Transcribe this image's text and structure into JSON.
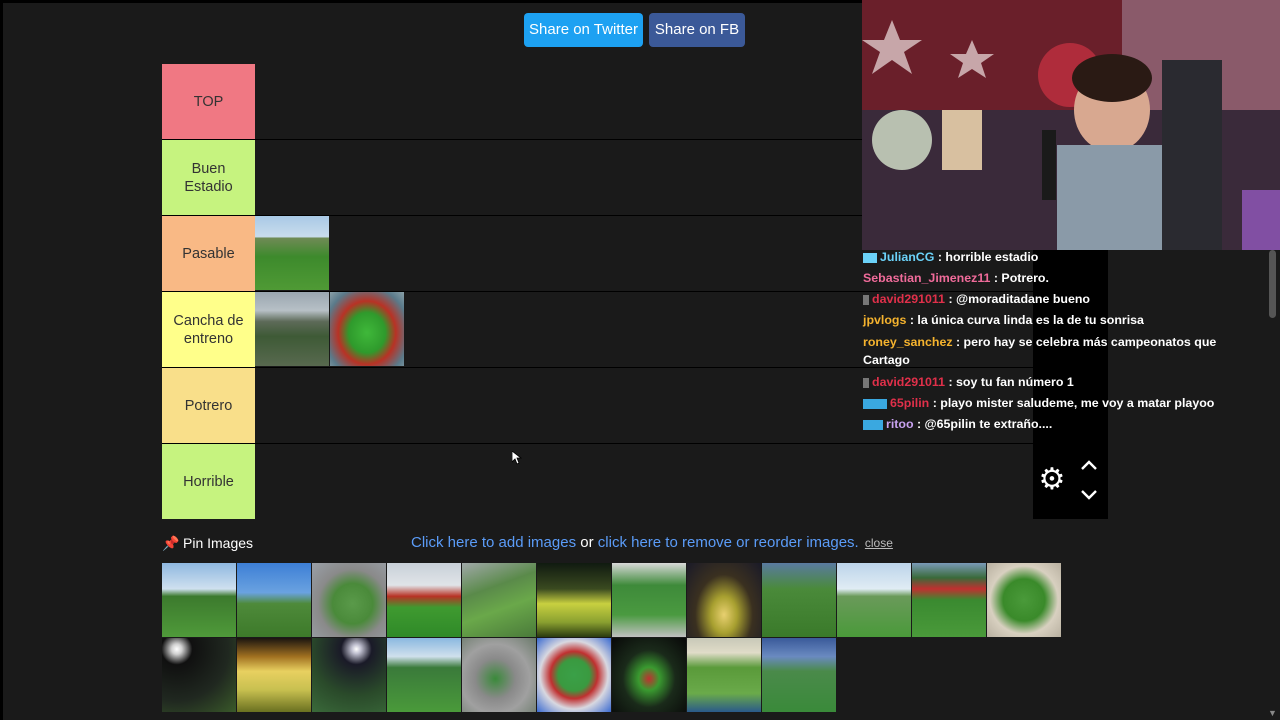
{
  "share": {
    "twitter_label": "Share on Twitter",
    "fb_label": "Share on FB"
  },
  "tiers": [
    {
      "label": "TOP",
      "color": "#f07883"
    },
    {
      "label": "Buen Estadio",
      "color": "#c6f37f"
    },
    {
      "label": "Pasable",
      "color": "#f9b985"
    },
    {
      "label": "Cancha de entreno",
      "color": "#ffff8a"
    },
    {
      "label": "Potrero",
      "color": "#f9df8a"
    },
    {
      "label": "Horrible",
      "color": "#c6f37f"
    }
  ],
  "controls": {
    "gear_icon": "gear-icon",
    "up_icon": "chevron-up-icon",
    "down_icon": "chevron-down-icon"
  },
  "pin": {
    "icon": "pin-icon",
    "label": "Pin Images",
    "add_link": "Click here to add images",
    "or_text": " or ",
    "reorder_link": "click here to remove or reorder images.",
    "close_label": "close"
  },
  "chat": {
    "messages": [
      {
        "user": "JulianCG",
        "user_color": "#6bd2f8",
        "text": " : horrible estadio"
      },
      {
        "user": "Sebastian_Jimenez11",
        "user_color": "#f06b9a",
        "text": " : Potrero."
      },
      {
        "user": "david291011",
        "user_color": "#e0304a",
        "text": " : @moraditadane bueno"
      },
      {
        "user": "jpvlogs",
        "user_color": "#f5b32e",
        "text": " : la única curva linda es la de tu sonrisa"
      },
      {
        "user": "roney_sanchez",
        "user_color": "#f5b32e",
        "text": " : pero hay se celebra más campeonatos que"
      },
      {
        "user": "",
        "user_color": "#ffffff",
        "text": "Cartago"
      },
      {
        "user": "david291011",
        "user_color": "#e0304a",
        "text": " : soy tu fan número 1"
      },
      {
        "user": "65pilin",
        "user_color": "#e0304a",
        "text": " : playo mister saludeme, me voy a matar playoo"
      },
      {
        "user": "ritoo",
        "user_color": "#c8a2f0",
        "text": " : @65pilin te extraño...."
      }
    ]
  }
}
